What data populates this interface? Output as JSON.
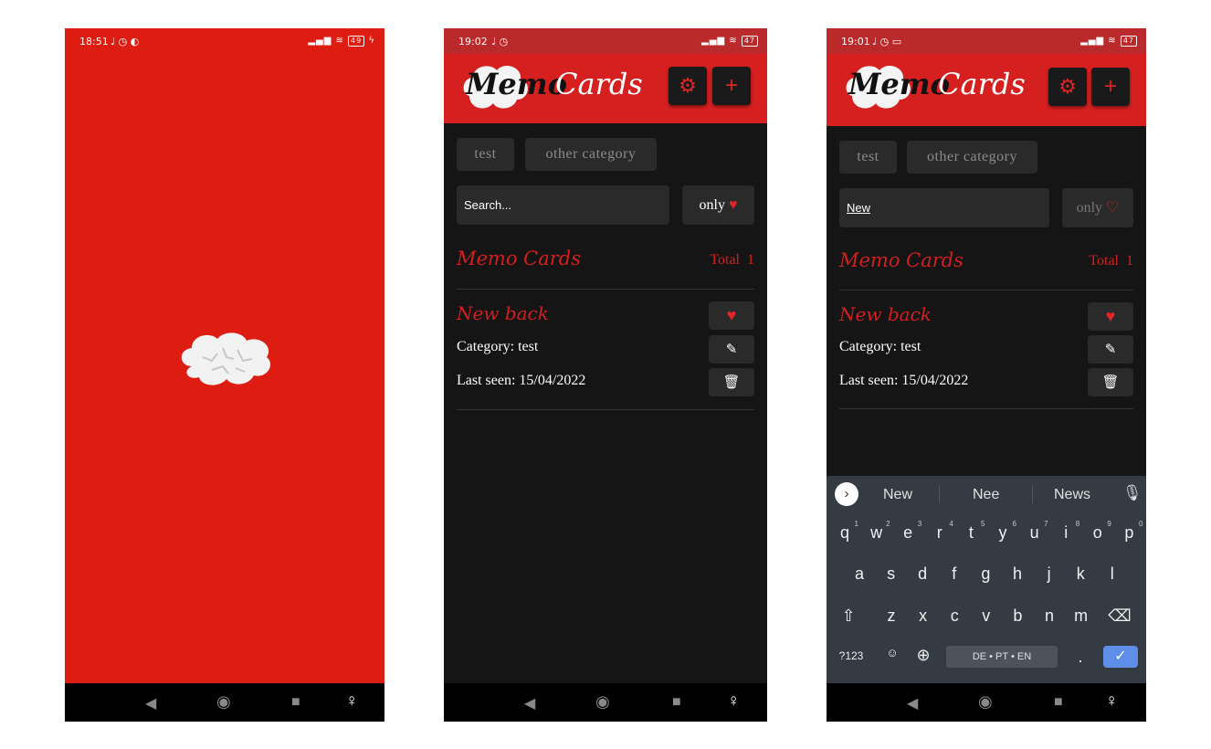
{
  "splash": {
    "status": {
      "time": "18:51",
      "icons": "♩ ◷ ◐",
      "battery": "49"
    }
  },
  "screen_list": {
    "status": {
      "time": "19:02",
      "battery": "47"
    },
    "logo": {
      "memo": "Memo",
      "cards": "Cards"
    },
    "categories": [
      "test",
      "other category"
    ],
    "search_placeholder": "Search...",
    "only_label": "only",
    "list_title": "Memo Cards",
    "total_label": "Total",
    "total_count": "1",
    "card": {
      "title": "New back",
      "category_label": "Category:",
      "category_value": "test",
      "last_seen_label": "Last seen:",
      "last_seen_value": "15/04/2022"
    }
  },
  "screen_search": {
    "status": {
      "time": "19:01",
      "battery": "47"
    },
    "logo": {
      "memo": "Memo",
      "cards": "Cards"
    },
    "categories": [
      "test",
      "other category"
    ],
    "search_value": "New",
    "only_label": "only",
    "list_title": "Memo Cards",
    "total_label": "Total",
    "total_count": "1",
    "card": {
      "title": "New back",
      "category_label": "Category:",
      "category_value": "test",
      "last_seen_label": "Last seen:",
      "last_seen_value": "15/04/2022"
    },
    "keyboard": {
      "suggestions": [
        "New",
        "Nee",
        "News"
      ],
      "row1": [
        "q",
        "w",
        "e",
        "r",
        "t",
        "y",
        "u",
        "i",
        "o",
        "p"
      ],
      "row1_hints": [
        "1",
        "2",
        "3",
        "4",
        "5",
        "6",
        "7",
        "8",
        "9",
        "0"
      ],
      "row2": [
        "a",
        "s",
        "d",
        "f",
        "g",
        "h",
        "j",
        "k",
        "l"
      ],
      "row3": [
        "z",
        "x",
        "c",
        "v",
        "b",
        "n",
        "m"
      ],
      "symbols_key": "?123",
      "space_label": "DE • PT • EN",
      "period_key": "."
    }
  },
  "colors": {
    "brand_red": "#dd1c12",
    "header_red": "#d61f1f",
    "background": "#151515",
    "chip": "#2a2a2a"
  }
}
